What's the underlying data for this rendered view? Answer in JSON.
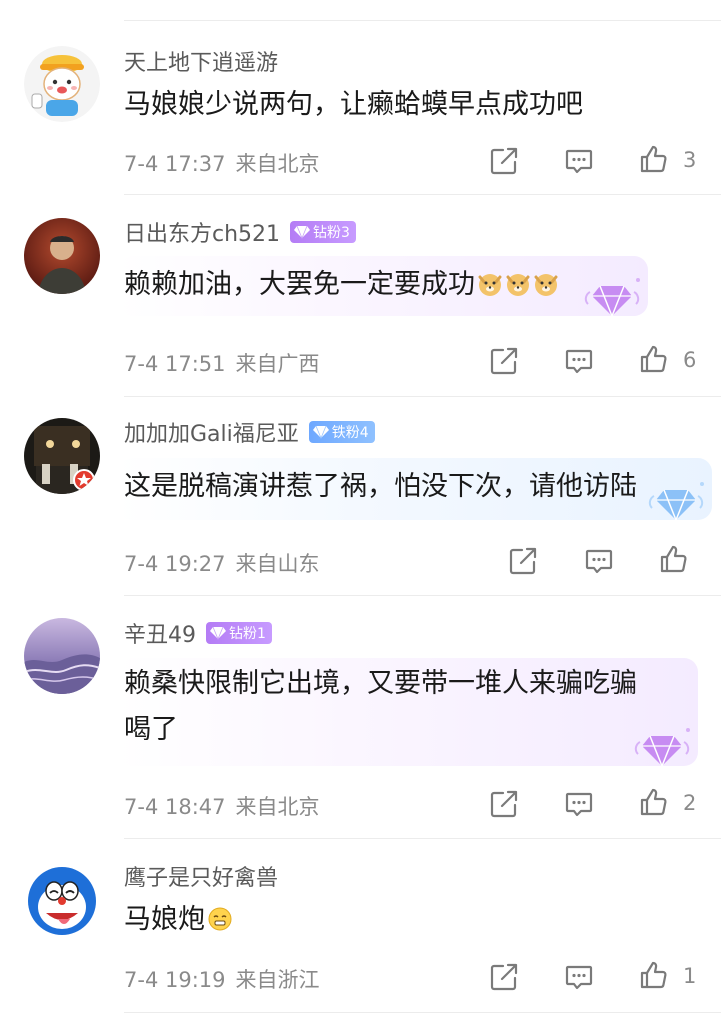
{
  "comments": [
    {
      "username": "天上地下逍遥游",
      "text": "马娘娘少说两句，让癞蛤蟆早点成功吧",
      "date": "7-4 17:37",
      "location": "来自北京",
      "likes": "3"
    },
    {
      "username": "日出东方ch521",
      "badge": "钻粉3",
      "text": "赖赖加油，大罢免一定要成功",
      "date": "7-4 17:51",
      "location": "来自广西",
      "likes": "6"
    },
    {
      "username": "加加加Gali福尼亚",
      "badge": "铁粉4",
      "text": "这是脱稿演讲惹了祸，怕没下次，请他访陆",
      "date": "7-4 19:27",
      "location": "来自山东",
      "likes": ""
    },
    {
      "username": "辛丑49",
      "badge": "钻粉1",
      "text_line1": "赖桑快限制它出境，又要带一堆人来骗吃骗",
      "text_line2": "喝了",
      "date": "7-4 18:47",
      "location": "来自北京",
      "likes": "2"
    },
    {
      "username": "鹰子是只好禽兽",
      "text": "马娘炮",
      "date": "7-4 19:19",
      "location": "来自浙江",
      "likes": "1"
    }
  ],
  "icons": {
    "share": "share-icon",
    "reply": "comment-icon",
    "like": "thumbs-up-icon"
  },
  "colors": {
    "zuan_badge": "#b47cf5",
    "tie_badge": "#6ea8ff",
    "meta_text": "#8a8a8a"
  }
}
